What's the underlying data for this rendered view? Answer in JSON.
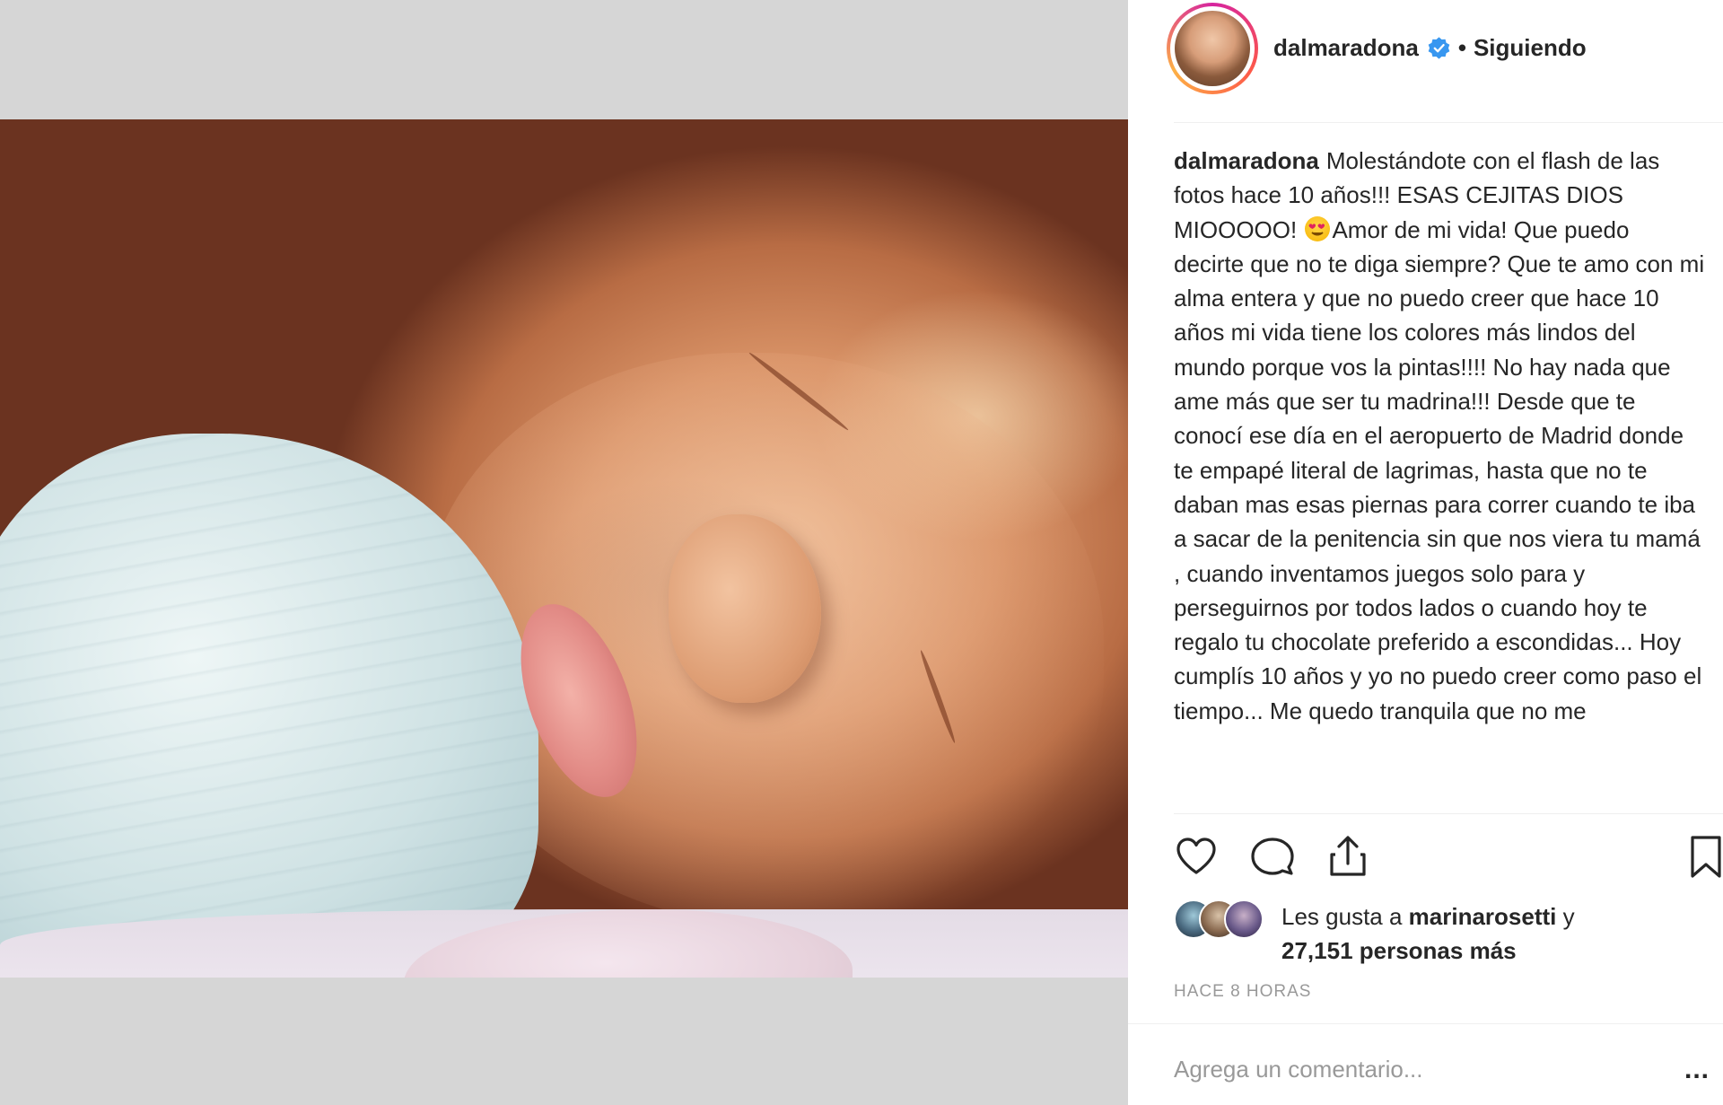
{
  "post": {
    "username": "dalmaradona",
    "follow_separator": "•",
    "follow_status": "Siguiendo",
    "caption_user": "dalmaradona",
    "caption_part1": "Molestándote con el flash de las fotos hace 10 años!!! ESAS CEJITAS DIOS MIOOOOO!",
    "caption_part2": "Amor de mi vida! Que puedo decirte que no te diga siempre? Que te amo con mi alma entera y que no puedo creer que hace 10 años mi vida tiene los colores más lindos del mundo porque vos la pintas!!!! No hay nada que ame más que ser tu madrina!!! Desde que te conocí ese día en el aeropuerto de Madrid donde te empapé literal de lagrimas, hasta que no te daban mas esas piernas para correr cuando te iba a sacar de la penitencia sin que nos viera tu mamá , cuando inventamos juegos solo para y perseguirnos por todos lados o cuando hoy te regalo tu chocolate preferido a escondidas... Hoy cumplís 10 años y yo no puedo creer como paso el tiempo... Me quedo tranquila que no me",
    "emoji": "heart-eyes-emoji",
    "likes_prefix": "Les gusta a",
    "likes_user": "marinarosetti",
    "likes_conj": "y",
    "likes_count": "27,151 personas más",
    "timestamp": "HACE 8 HORAS",
    "comment_placeholder": "Agrega un comentario...",
    "more_label": "..."
  },
  "icons": {
    "verified": "verified-badge-icon",
    "like": "heart-icon",
    "comment": "comment-bubble-icon",
    "share": "share-upload-icon",
    "save": "bookmark-icon",
    "options": "more-options-icon"
  },
  "colors": {
    "verified_blue": "#3897f0",
    "text": "#262626",
    "muted": "#999999",
    "media_background": "#d6d6d6"
  }
}
